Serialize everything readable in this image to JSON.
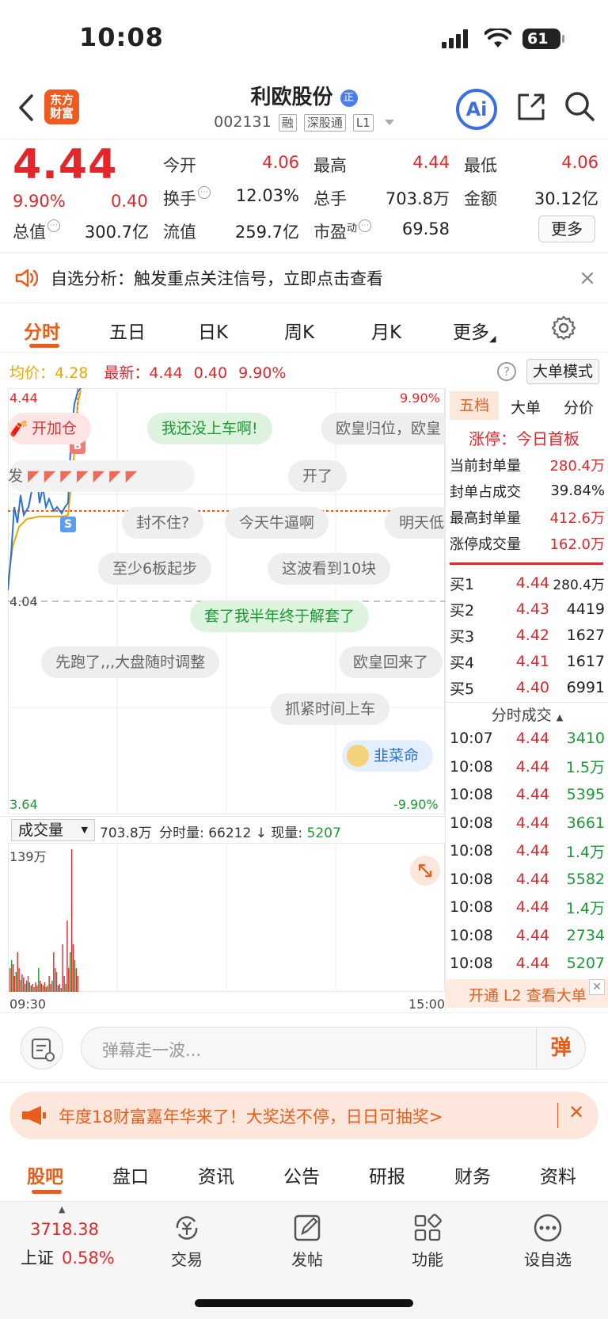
{
  "status": {
    "time": "10:08",
    "battery": "61"
  },
  "header": {
    "logo_text": "东方财富",
    "title": "利欧股份",
    "title_badge": "正",
    "code": "002131",
    "tags": [
      "融",
      "深股通",
      "L1"
    ],
    "ai_label": "Ai"
  },
  "quote": {
    "price": "4.44",
    "change_pct": "9.90%",
    "change": "0.40",
    "open_label": "今开",
    "open": "4.06",
    "high_label": "最高",
    "high": "4.44",
    "low_label": "最低",
    "low": "4.06",
    "turnover_label": "换手",
    "turnover": "12.03%",
    "volume_label": "总手",
    "volume": "703.8万",
    "amount_label": "金额",
    "amount": "30.12亿",
    "mktcap_label": "总值",
    "mktcap": "300.7亿",
    "float_label": "流值",
    "float": "259.7亿",
    "pe_label": "市盈",
    "pe_sup": "动",
    "pe": "69.58",
    "more_label": "更多"
  },
  "alert": {
    "text": "自选分析：触发重点关注信号，立即点击查看"
  },
  "tabs": [
    "分时",
    "五日",
    "日K",
    "周K",
    "月K",
    "更多"
  ],
  "chart": {
    "avg_label": "均价：",
    "avg": "4.28",
    "latest_label": "最新：",
    "latest": "4.44",
    "latest_change": "0.40",
    "latest_pct": "9.90%",
    "mode_label": "大单模式",
    "y_top": "4.44",
    "y_mid": "4.04",
    "y_bottom": "3.64",
    "pct_top": "9.90%",
    "pct_bottom": "-9.90%",
    "marker_b": "B",
    "marker_s": "S",
    "bubbles": [
      "开加仓",
      "我还没上车啊!",
      "欧皇归位，欧皇",
      "发",
      "开了",
      "封不住?",
      "今天牛逼啊",
      "明天低",
      "至少6板起步",
      "这波看到10块",
      "套了我半年终于解套了",
      "先跑了,,,大盘随时调整",
      "欧皇回来了",
      "抓紧时间上车",
      "韭菜命"
    ],
    "volume_select": "成交量",
    "volume_total": "703.8万",
    "volume_period_label": "分时量:",
    "volume_period": "66212",
    "volume_now_label": "现量:",
    "volume_now": "5207",
    "volume_max": "139万",
    "time_start": "09:30",
    "time_end": "15:00"
  },
  "orderbook": {
    "tabs": [
      "五档",
      "大单",
      "分价"
    ],
    "limit_label": "涨停：",
    "limit_text": "今日首板",
    "stats": [
      {
        "label": "当前封单量",
        "value": "280.4万"
      },
      {
        "label": "封单占成交",
        "value": "39.84%"
      },
      {
        "label": "最高封单量",
        "value": "412.6万"
      },
      {
        "label": "涨停成交量",
        "value": "162.0万"
      }
    ],
    "bids": [
      {
        "label": "买1",
        "price": "4.44",
        "qty": "280.4万"
      },
      {
        "label": "买2",
        "price": "4.43",
        "qty": "4419"
      },
      {
        "label": "买3",
        "price": "4.42",
        "qty": "1627"
      },
      {
        "label": "买4",
        "price": "4.41",
        "qty": "1617"
      },
      {
        "label": "买5",
        "price": "4.40",
        "qty": "6991"
      }
    ],
    "ticks_title": "分时成交",
    "ticks": [
      {
        "time": "10:07",
        "price": "4.44",
        "qty": "3410"
      },
      {
        "time": "10:08",
        "price": "4.44",
        "qty": "1.5万"
      },
      {
        "time": "10:08",
        "price": "4.44",
        "qty": "5395"
      },
      {
        "time": "10:08",
        "price": "4.44",
        "qty": "3661"
      },
      {
        "time": "10:08",
        "price": "4.44",
        "qty": "1.4万"
      },
      {
        "time": "10:08",
        "price": "4.44",
        "qty": "5582"
      },
      {
        "time": "10:08",
        "price": "4.44",
        "qty": "1.4万"
      },
      {
        "time": "10:08",
        "price": "4.44",
        "qty": "2734"
      },
      {
        "time": "10:08",
        "price": "4.44",
        "qty": "5207"
      }
    ],
    "l2_promo": "开通 L2 查看大单"
  },
  "danmu": {
    "placeholder": "弹幕走一波...",
    "send_label": "弹"
  },
  "banner": {
    "text": "年度18财富嘉年华来了！大奖送不停，日日可抽奖>"
  },
  "bottom_tabs": [
    "股吧",
    "盘口",
    "资讯",
    "公告",
    "研报",
    "财务",
    "资料"
  ],
  "bottom_nav": {
    "index_value": "3718.38",
    "index_name": "上证",
    "index_change": "0.58%",
    "items": [
      "交易",
      "发帖",
      "功能",
      "设自选"
    ]
  },
  "colors": {
    "up": "#e4262b",
    "down": "#1a9a34",
    "accent": "#e85d1c",
    "avg_line": "#f0a500",
    "price_line": "#2b6fd8"
  }
}
